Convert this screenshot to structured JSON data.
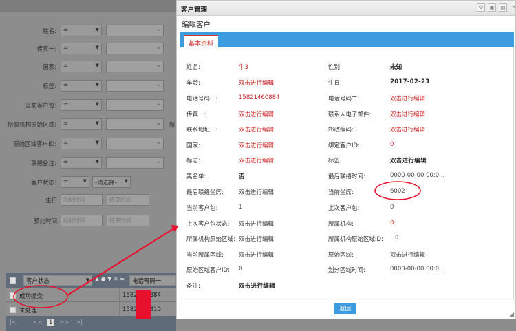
{
  "background": {
    "filters": [
      {
        "label": "姓名:",
        "op": "=",
        "type": "text"
      },
      {
        "label": "传真一:",
        "op": "=",
        "type": "text"
      },
      {
        "label": "国家:",
        "op": "=",
        "type": "text"
      },
      {
        "label": "标签:",
        "op": "=",
        "type": "text"
      },
      {
        "label": "当前客户包:",
        "op": "=",
        "type": "text"
      },
      {
        "label": "所属机构原始区域:",
        "op": "=",
        "type": "text",
        "extra": "所"
      },
      {
        "label": "原始区域客户ID:",
        "op": "=",
        "type": "text"
      },
      {
        "label": "联络备注:",
        "op": "=",
        "type": "text"
      },
      {
        "label": "客户状态:",
        "op": "=",
        "type": "select",
        "select_value": "-请选择-"
      },
      {
        "label": "生日:",
        "type": "date",
        "from_placeholder": "起始时间",
        "to_placeholder": "结束时间"
      },
      {
        "label": "预约时间:",
        "type": "date",
        "from_placeholder": "起始时间",
        "to_placeholder": "结束时间"
      }
    ],
    "grid": {
      "filter_status": "客户状态",
      "filter_phone": "电话号码一",
      "controls": "▲ ● ▼ ✕ ⇔",
      "rows": [
        {
          "status": "成功提交",
          "phone": "1582",
          "phone_suffix": "884"
        },
        {
          "status": "未处理",
          "phone": "1582",
          "phone_suffix": "810"
        }
      ],
      "pager": {
        "first": "|<",
        "prev": "<<",
        "current": "1",
        "next": ">>",
        "last": ">|"
      }
    }
  },
  "dialog": {
    "title": "客户管理",
    "subtitle": "编辑客户",
    "tab": "基本资料",
    "fields_left": [
      {
        "label": "姓名:",
        "value": "牛3",
        "style": "red"
      },
      {
        "label": "年龄:",
        "value": "双击进行编辑",
        "style": "red"
      },
      {
        "label": "电话号码一:",
        "value": "15821460884",
        "style": "red"
      },
      {
        "label": "传真一:",
        "value": "双击进行编辑",
        "style": "red"
      },
      {
        "label": "联系地址一:",
        "value": "双击进行编辑",
        "style": "red"
      },
      {
        "label": "国家:",
        "value": "双击进行编辑",
        "style": "red"
      },
      {
        "label": "标志:",
        "value": "双击进行编辑",
        "style": "red"
      },
      {
        "label": "黑名单:",
        "value": "否",
        "style": "bold"
      },
      {
        "label": "最后联络坐席:",
        "value": "双击进行编辑",
        "style": "grey"
      },
      {
        "label": "当前客户包:",
        "value": "1",
        "style": "grey"
      },
      {
        "label": "上次客户包状态:",
        "value": "双击进行编辑",
        "style": "grey"
      },
      {
        "label": "所属机构原始区域:",
        "value": "双击进行编辑",
        "style": "grey"
      },
      {
        "label": "当前所属区域:",
        "value": "双击进行编辑",
        "style": "grey"
      },
      {
        "label": "原始区域客户ID:",
        "value": "0",
        "style": "grey"
      },
      {
        "label": "备注:",
        "value": "双击进行编辑",
        "style": "bold"
      }
    ],
    "fields_right": [
      {
        "label": "性别:",
        "value": "未知",
        "style": "bold"
      },
      {
        "label": "生日:",
        "value": "2017-02-23",
        "style": "bold"
      },
      {
        "label": "电话号码二:",
        "value": "双击进行编辑",
        "style": "red"
      },
      {
        "label": "联系人电子邮件:",
        "value": "双击进行编辑",
        "style": "red"
      },
      {
        "label": "邮政编码:",
        "value": "双击进行编辑",
        "style": "red"
      },
      {
        "label": "绑定客户ID:",
        "value": "0",
        "style": "red"
      },
      {
        "label": "标签:",
        "value": "双击进行编辑",
        "style": "bold"
      },
      {
        "label": "最后联络时间:",
        "value": "0000-00-00 00:0...",
        "style": "grey"
      },
      {
        "label": "当前坐席:",
        "value": "6002",
        "style": "grey"
      },
      {
        "label": "上次客户包:",
        "value": "0",
        "style": "grey"
      },
      {
        "label": "所属机构:",
        "value": "0",
        "style": "red"
      },
      {
        "label": "所属机构原始区域ID:",
        "value": "0",
        "style": "grey"
      },
      {
        "label": "原始区域:",
        "value": "双击进行编辑",
        "style": "grey"
      },
      {
        "label": "划分区域时间:",
        "value": "0000-00-00 00:0...",
        "style": "grey"
      }
    ],
    "back_button": "返回"
  },
  "colors": {
    "accent": "#3d9be0",
    "edit_red": "#cc2222",
    "annotation_red": "#e8112d"
  }
}
